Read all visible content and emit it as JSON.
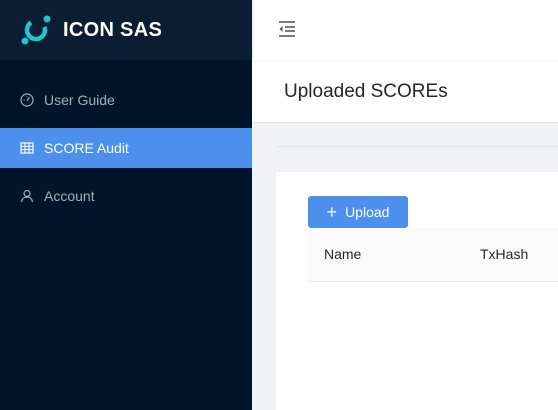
{
  "brand": {
    "name": "ICON SAS"
  },
  "sidebar": {
    "items": [
      {
        "label": "User Guide",
        "icon": "dashboard-icon",
        "active": false
      },
      {
        "label": "SCORE Audit",
        "icon": "table-icon",
        "active": true
      },
      {
        "label": "Account",
        "icon": "user-icon",
        "active": false
      }
    ]
  },
  "header": {
    "fold_icon": "menu-fold-icon"
  },
  "page": {
    "title": "Uploaded SCOREs"
  },
  "toolbar": {
    "upload_label": "Upload"
  },
  "table": {
    "columns": [
      "Name",
      "TxHash"
    ]
  },
  "colors": {
    "sidebar_bg": "#001529",
    "accent": "#4c8fec",
    "logo_teal": "#1fc5c9"
  }
}
